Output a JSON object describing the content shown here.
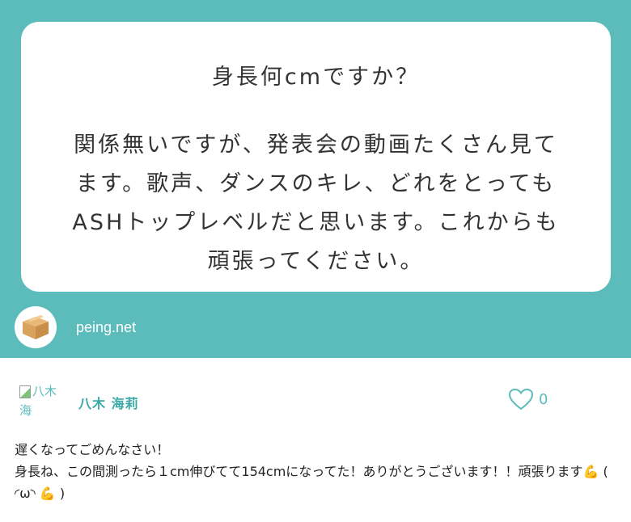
{
  "question": {
    "title": "身長何cmですか？",
    "body": "関係無いですが、発表会の動画たくさん見てます。歌声、ダンスのキレ、どれをとってもASHトップレベルだと思います。これからも頑張ってください。"
  },
  "brand": {
    "logo_icon": "cardboard-box-icon",
    "name": "peing.net"
  },
  "answer": {
    "avatar_alt": "八木 海",
    "user_name": "八木 海莉",
    "like_icon": "heart-outline-icon",
    "like_count": "0",
    "line1": "遅くなってごめんなさい！",
    "line2": "身長ね、この間測ったら１cm伸びてて154cmになってた！ありがとうございます！！頑張ります💪 ( ◜ω◝ 💪 )"
  },
  "colors": {
    "accent": "#5bbcbb",
    "bubble": "#ffffff",
    "name": "#3aa9a6"
  }
}
